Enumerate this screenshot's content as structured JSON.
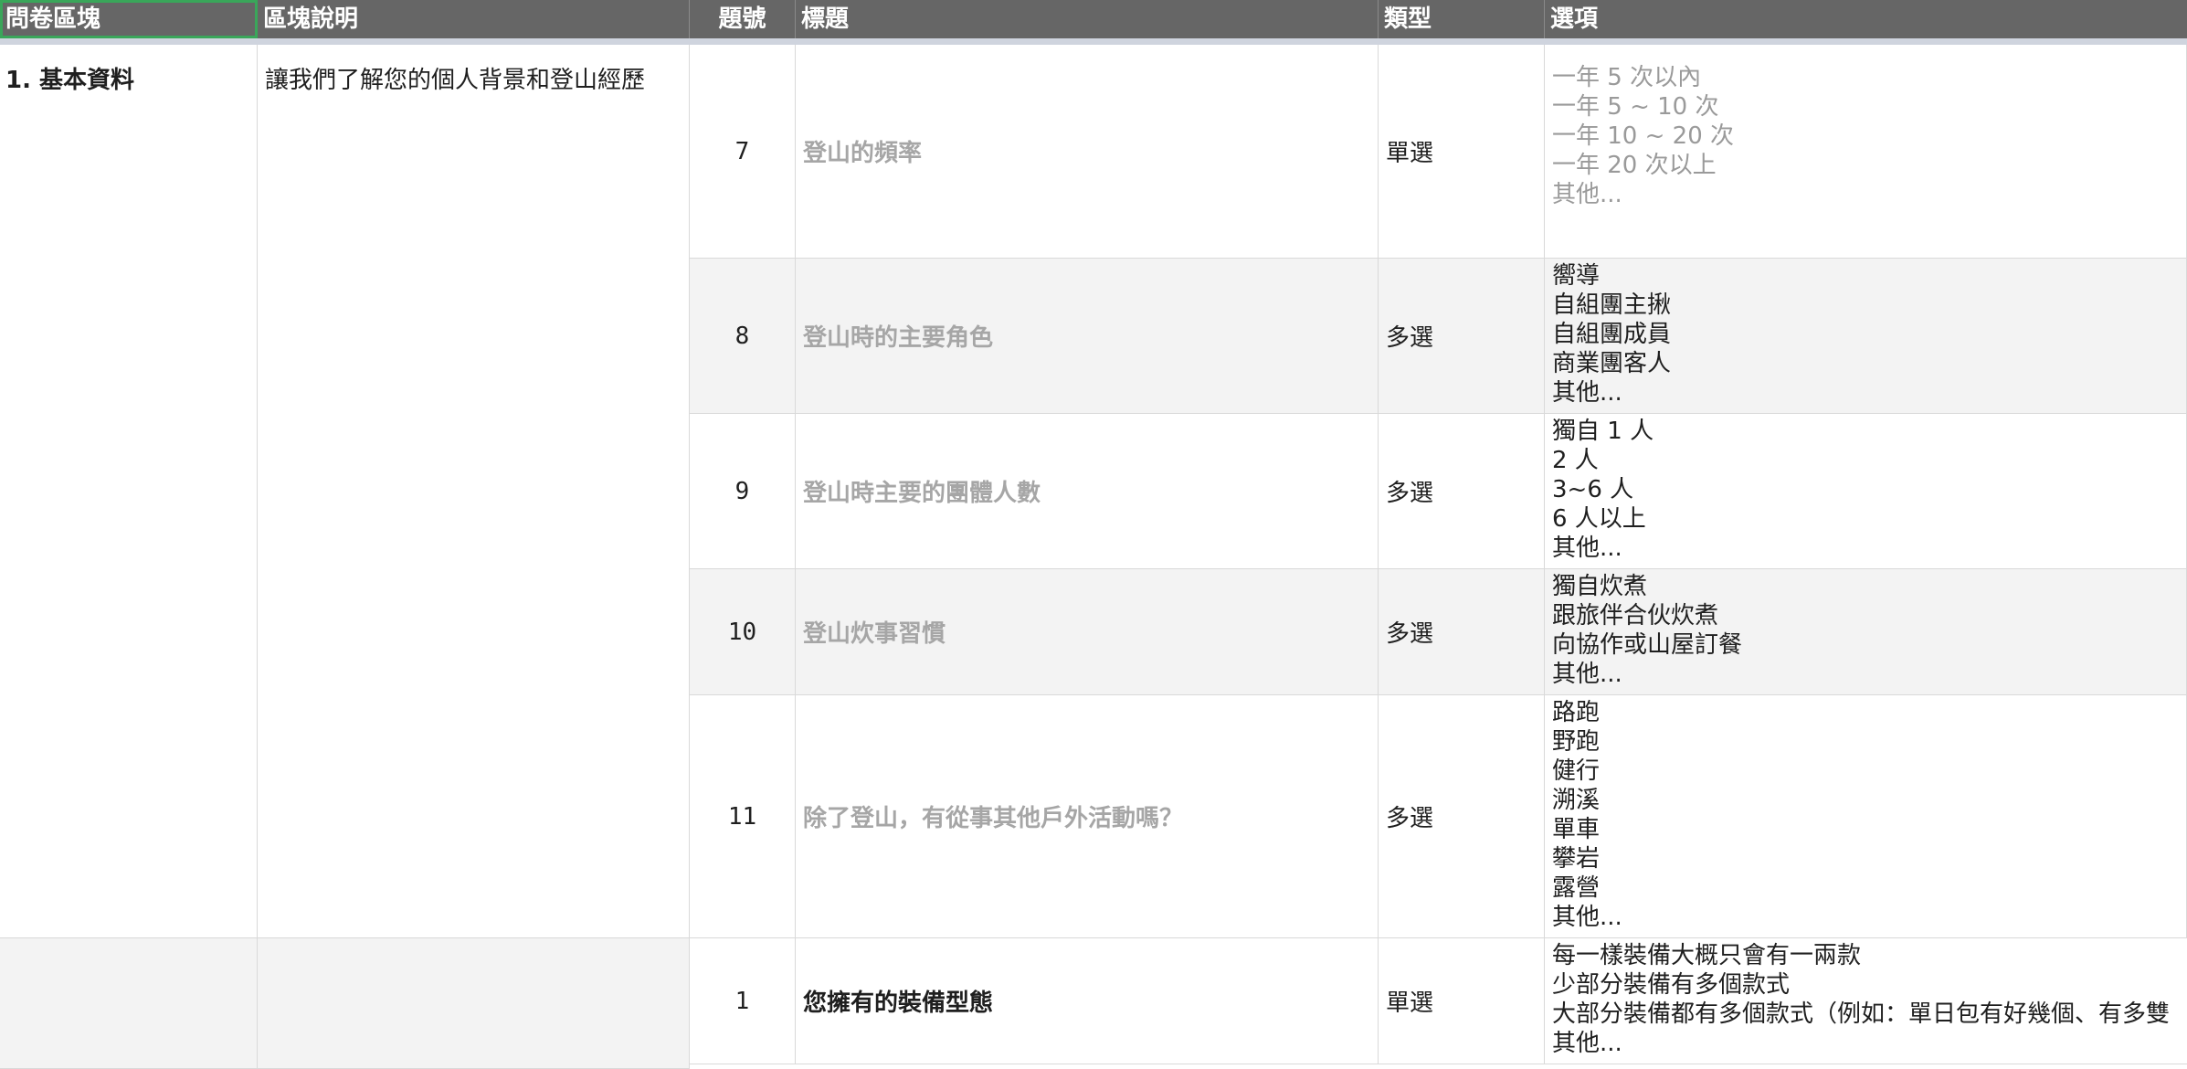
{
  "header": {
    "block": "問卷區塊",
    "block_desc": "區塊說明",
    "number": "題號",
    "title": "標題",
    "type": "類型",
    "options": "選項"
  },
  "block1": {
    "name": "1. 基本資料",
    "description": "讓我們了解您的個人背景和登山經歷"
  },
  "rows": [
    {
      "number": "7",
      "title": "登山的頻率",
      "type": "單選",
      "options": [
        "一年 5 次以內",
        "一年 5 ~ 10 次",
        "一年 10 ~ 20 次",
        "一年 20 次以上",
        "其他..."
      ]
    },
    {
      "number": "8",
      "title": "登山時的主要角色",
      "type": "多選",
      "options": [
        "嚮導",
        "自組團主揪",
        "自組團成員",
        "商業團客人",
        "其他..."
      ]
    },
    {
      "number": "9",
      "title": "登山時主要的團體人數",
      "type": "多選",
      "options": [
        "獨自 1 人",
        "2 人",
        "3~6 人",
        "6 人以上",
        "其他..."
      ]
    },
    {
      "number": "10",
      "title": "登山炊事習慣",
      "type": "多選",
      "options": [
        "獨自炊煮",
        "跟旅伴合伙炊煮",
        "向協作或山屋訂餐",
        "其他..."
      ]
    },
    {
      "number": "11",
      "title": "除了登山，有從事其他戶外活動嗎？",
      "type": "多選",
      "options": [
        "路跑",
        "野跑",
        "健行",
        "溯溪",
        "單車",
        "攀岩",
        "露營",
        "其他..."
      ]
    },
    {
      "number": "1",
      "title": "您擁有的裝備型態",
      "type": "單選",
      "options": [
        "每一樣裝備大概只會有一兩款",
        "少部分裝備有多個款式",
        "大部分裝備都有多個款式（例如：單日包有好幾個、有多雙",
        "其他..."
      ]
    }
  ]
}
